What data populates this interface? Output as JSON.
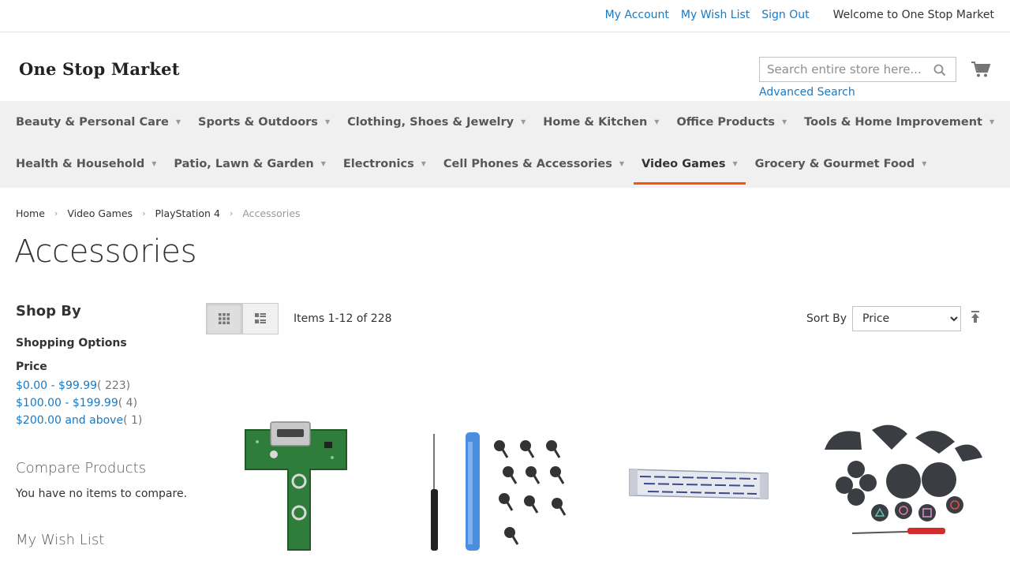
{
  "top_links": {
    "my_account": "My Account",
    "my_wish_list": "My Wish List",
    "sign_out": "Sign Out",
    "welcome": "Welcome to One Stop Market"
  },
  "header": {
    "logo": "One Stop Market",
    "search_placeholder": "Search entire store here...",
    "advanced_search": "Advanced Search"
  },
  "nav": {
    "row1": [
      {
        "label": "Beauty & Personal Care"
      },
      {
        "label": "Sports & Outdoors"
      },
      {
        "label": "Clothing, Shoes & Jewelry"
      },
      {
        "label": "Home & Kitchen"
      },
      {
        "label": "Office Products"
      },
      {
        "label": "Tools & Home Improvement"
      }
    ],
    "row2": [
      {
        "label": "Health & Household"
      },
      {
        "label": "Patio, Lawn & Garden"
      },
      {
        "label": "Electronics"
      },
      {
        "label": "Cell Phones & Accessories"
      },
      {
        "label": "Video Games",
        "active": true
      },
      {
        "label": "Grocery & Gourmet Food"
      }
    ]
  },
  "breadcrumbs": [
    "Home",
    "Video Games",
    "PlayStation 4",
    "Accessories"
  ],
  "page_title": "Accessories",
  "sidebar": {
    "shop_by": "Shop By",
    "shopping_options": "Shopping Options",
    "price_title": "Price",
    "price_filters": [
      {
        "label": "$0.00 - $99.99",
        "count": "( 223)"
      },
      {
        "label": "$100.00 - $199.99",
        "count": "( 4)"
      },
      {
        "label": "$200.00 and above",
        "count": "( 1)"
      }
    ],
    "compare_title": "Compare Products",
    "compare_text": "You have no items to compare.",
    "wish_title": "My Wish List"
  },
  "toolbar": {
    "amount": "Items 1-12 of 228",
    "sort_label": "Sort By",
    "sort_selected": "Price"
  },
  "colors": {
    "link": "#1979c3",
    "nav_bg": "#f0f0f0",
    "active_underline": "#ff5501"
  },
  "icons": [
    "search-icon",
    "cart-icon",
    "grid-icon",
    "list-icon",
    "sort-direction-icon",
    "chevron-right-icon"
  ]
}
